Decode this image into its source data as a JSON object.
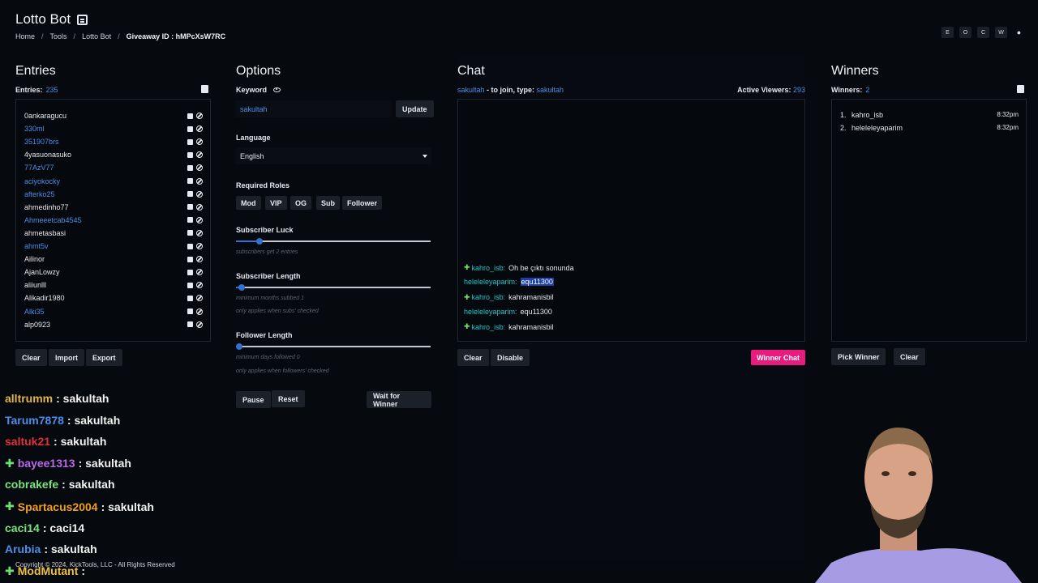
{
  "app": {
    "title": "Lotto Bot"
  },
  "breadcrumb": {
    "home": "Home",
    "tools": "Tools",
    "current": "Lotto Bot",
    "giveaway": "Giveaway ID : hMPcXsW7RC"
  },
  "top_icons": [
    "E",
    "O",
    "C",
    "W",
    "●"
  ],
  "entries": {
    "title": "Entries",
    "count_label": "Entries:",
    "count": "235",
    "items": [
      {
        "name": "0ankaragucu",
        "color": "#e6e9ef"
      },
      {
        "name": "330ml",
        "color": "#4c8fe8"
      },
      {
        "name": "351907brs",
        "color": "#4c8fe8"
      },
      {
        "name": "4yasuonasuko",
        "color": "#e6e9ef"
      },
      {
        "name": "77AzV77",
        "color": "#4c8fe8"
      },
      {
        "name": "aciyokocky",
        "color": "#4c8fe8"
      },
      {
        "name": "afterko25",
        "color": "#4c8fe8"
      },
      {
        "name": "ahmedinho77",
        "color": "#e6e9ef"
      },
      {
        "name": "Ahmeeetcab4545",
        "color": "#4c8fe8"
      },
      {
        "name": "ahmetasbasi",
        "color": "#e6e9ef"
      },
      {
        "name": "ahmt5v",
        "color": "#4c8fe8"
      },
      {
        "name": "Ailinor",
        "color": "#e6e9ef"
      },
      {
        "name": "AjanLowzy",
        "color": "#e6e9ef"
      },
      {
        "name": "aliiunlll",
        "color": "#e6e9ef"
      },
      {
        "name": "Alikadir1980",
        "color": "#e6e9ef"
      },
      {
        "name": "Alki35",
        "color": "#4c8fe8"
      },
      {
        "name": "alp0923",
        "color": "#e6e9ef"
      }
    ],
    "buttons": {
      "clear": "Clear",
      "import": "Import",
      "export": "Export"
    }
  },
  "options": {
    "title": "Options",
    "keyword_label": "Keyword",
    "keyword_value": "sakultah",
    "update_label": "Update",
    "language_label": "Language",
    "language_value": "English",
    "roles_label": "Required Roles",
    "roles": [
      "Mod",
      "VIP",
      "OG",
      "Sub",
      "Follower"
    ],
    "sub_luck_label": "Subscriber Luck",
    "sub_luck_hint": "subscribers get 2 entries",
    "sub_luck_value": 0.12,
    "sub_length_label": "Subscriber Length",
    "sub_length_hint1": "minimum months subbed 1",
    "sub_length_hint2": "only applies when subs' checked",
    "sub_length_value": 0.03,
    "follower_length_label": "Follower Length",
    "follower_length_hint1": "minimum days followed 0",
    "follower_length_hint2": "only applies when followers' checked",
    "follower_length_value": 0.0,
    "buttons": {
      "pause": "Pause",
      "reset": "Reset",
      "wait": "Wait for Winner"
    }
  },
  "chat": {
    "title": "Chat",
    "join_user": "sakultah",
    "join_text": " - to join, type: ",
    "join_keyword": "sakultah",
    "viewers_label": "Active Viewers:",
    "viewers": "293",
    "messages": [
      {
        "user": "kahro_isb:",
        "text": "Oh be çıktı sonunda",
        "badge": true,
        "highlight": false
      },
      {
        "user": "heleleleyaparim:",
        "text": "equ11300",
        "badge": false,
        "highlight": true
      },
      {
        "user": "kahro_isb:",
        "text": "kahramanisbil",
        "badge": true,
        "highlight": false
      },
      {
        "user": "heleleleyaparim:",
        "text": "equ11300",
        "badge": false,
        "highlight": false
      },
      {
        "user": "kahro_isb:",
        "text": "kahramanisbil",
        "badge": true,
        "highlight": false
      }
    ],
    "buttons": {
      "clear": "Clear",
      "disable": "Disable",
      "winner_chat": "Winner Chat"
    }
  },
  "winners": {
    "title": "Winners",
    "count_label": "Winners:",
    "count": "2",
    "items": [
      {
        "idx": "1.",
        "name": "kahro_isb",
        "time": "8:32pm"
      },
      {
        "idx": "2.",
        "name": "heleleleyaparim",
        "time": "8:32pm"
      }
    ],
    "buttons": {
      "pick": "Pick Winner",
      "clear": "Clear"
    }
  },
  "stream_overlay": [
    {
      "user": "alltrumm",
      "msg": ": sakultah",
      "color": "#e0b64a",
      "badge": false
    },
    {
      "user": "Tarum7878",
      "msg": ": sakultah",
      "color": "#4c8fe8",
      "badge": false
    },
    {
      "user": "saltuk21",
      "msg": ": sakultah",
      "color": "#e0303a",
      "badge": false
    },
    {
      "user": "bayee1313",
      "msg": ": sakultah",
      "color": "#b968e6",
      "badge": true
    },
    {
      "user": "cobrakefe",
      "msg": ": sakultah",
      "color": "#7be37b",
      "badge": false
    },
    {
      "user": "Spartacus2004",
      "msg": ": sakultah",
      "color": "#f0a020",
      "badge": true
    },
    {
      "user": "caci14",
      "msg": ": caci14",
      "color": "#7be37b",
      "badge": false
    },
    {
      "user": "Arubia",
      "msg": ": sakultah",
      "color": "#4c8fe8",
      "badge": false
    },
    {
      "user": "ModMutant",
      "msg": ":",
      "color": "#f0c040",
      "badge": true
    }
  ],
  "footer": "Copyright © 2024, KickTools, LLC - All Rights Reserved"
}
